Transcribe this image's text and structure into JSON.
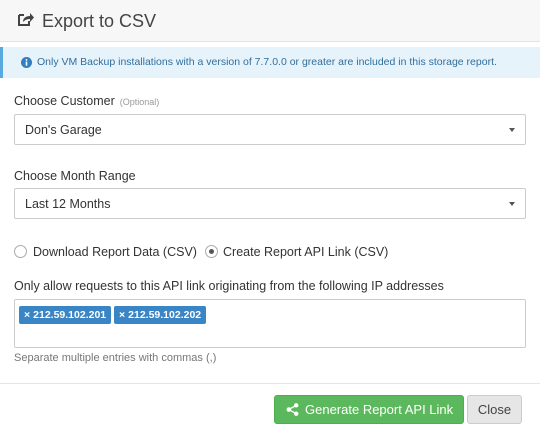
{
  "header": {
    "title": "Export to CSV",
    "icon": "share-square-icon"
  },
  "alert": {
    "text": "Only VM Backup installations with a version of 7.7.0.0 or greater are included in this storage report.",
    "icon": "info-circle-icon",
    "color": "#5aa9de"
  },
  "customer": {
    "label": "Choose Customer",
    "optional": "(Optional)",
    "value": "Don's Garage"
  },
  "month_range": {
    "label": "Choose Month Range",
    "value": "Last 12 Months"
  },
  "report_type": {
    "options": [
      {
        "label": "Download Report Data (CSV)",
        "checked": false
      },
      {
        "label": "Create Report API Link (CSV)",
        "checked": true
      }
    ]
  },
  "ip_filter": {
    "label": "Only allow requests to this API link originating from the following IP addresses",
    "tags": [
      "212.59.102.201",
      "212.59.102.202"
    ],
    "remove_symbol": "×",
    "help": "Separate multiple entries with commas (,)"
  },
  "footer": {
    "generate_label": "Generate Report API Link",
    "generate_icon": "share-alt-icon",
    "close_label": "Close",
    "accent": "#5cb85c"
  }
}
